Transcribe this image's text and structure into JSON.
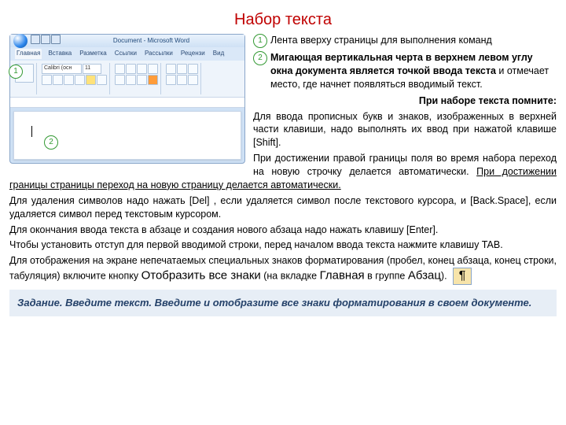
{
  "title": "Набор текста",
  "screenshot": {
    "docTitle": "Document - Microsoft Word",
    "tabs": [
      "Главная",
      "Вставка",
      "Разметка",
      "Ссылки",
      "Рассылки",
      "Рецензи",
      "Вид"
    ],
    "fontBox": "Calibri (осн",
    "sizeBox": "11"
  },
  "markers": {
    "one": "1",
    "two": "2"
  },
  "callout1": "Лента вверху страницы для выполнения команд",
  "callout2_bold": "Мигающая вертикальная черта в верхнем левом углу окна документа является точкой ввода текста",
  "callout2_rest": " и отмечает место, где начнет появляться вводимый текст.",
  "reminder": "При наборе текста помните:",
  "p1": "Для ввода прописных букв и знаков, изображенных  в верхней части клавиши, надо выполнять их ввод при нажатой клавише [Shift].",
  "p2a": "При достижении  правой границы поля во время набора переход на новую строчку делается автоматически. ",
  "p2b": "При достижении границы страницы переход на новую страницу делается автоматически.",
  "p3": "Для удаления символов надо нажать [Del] , если удаляется символ после текстового курсора, и  [Back.Space],  если удаляется символ перед  текстовым курсором.",
  "p4": "Для окончания ввода текста в абзаце и создания нового абзаца надо нажать клавишу [Enter].",
  "p5": "Чтобы установить отступ для первой вводимой строки, перед началом ввода текста нажмите клавишу TAB.",
  "p6a": "Для отображения на экране непечатаемых  специальных знаков форматирования (пробел, конец абзаца, конец строки, табуляция) включите кнопку ",
  "p6_btn": "Отобразить все знаки",
  "p6b": " (на вкладке ",
  "p6_tab": "Главная",
  "p6c": " в группе ",
  "p6_grp": "Абзац",
  "p6d": ").",
  "pilcrow": "¶",
  "task_label": "Задание. Введите текст.",
  "task_text": " Введите и отобразите все знаки форматирования в своем документе."
}
